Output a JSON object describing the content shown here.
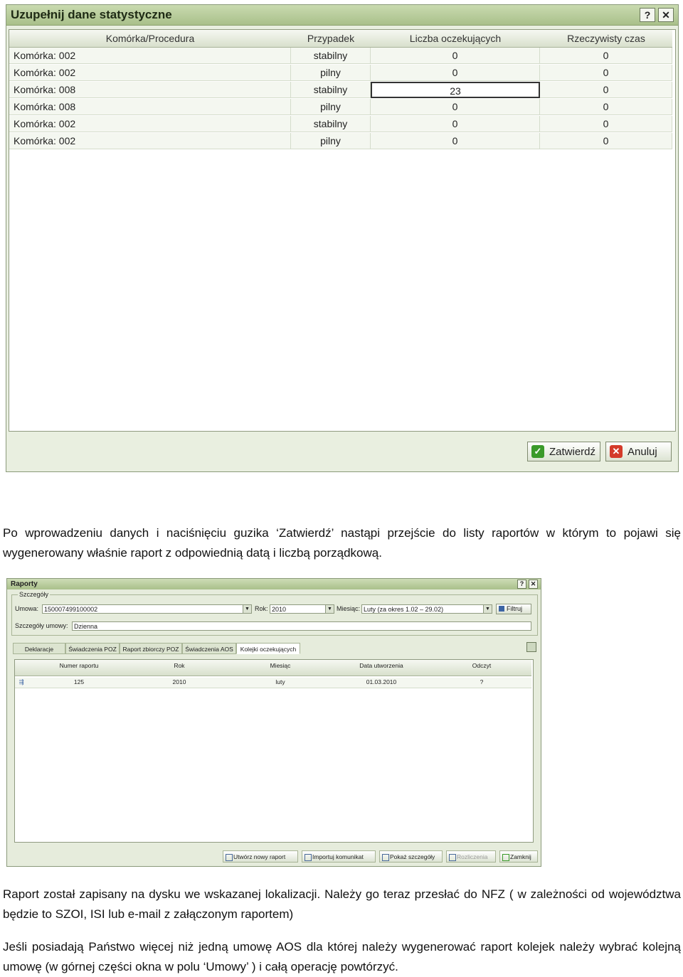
{
  "window1": {
    "title": "Uzupełnij dane statystyczne",
    "help": "?",
    "close": "✕",
    "columns": [
      "Komórka/Procedura",
      "Przypadek",
      "Liczba oczekujących",
      "Rzeczywisty czas"
    ],
    "rows": [
      {
        "cell": "Komórka:   002",
        "case": "stabilny",
        "waiting": "0",
        "time": "0"
      },
      {
        "cell": "Komórka:   002",
        "case": "pilny",
        "waiting": "0",
        "time": "0"
      },
      {
        "cell": "Komórka:   008",
        "case": "stabilny",
        "waiting": "23",
        "time": "0"
      },
      {
        "cell": "Komórka:   008",
        "case": "pilny",
        "waiting": "0",
        "time": "0"
      },
      {
        "cell": "Komórka:   002",
        "case": "stabilny",
        "waiting": "0",
        "time": "0"
      },
      {
        "cell": "Komórka:   002",
        "case": "pilny",
        "waiting": "0",
        "time": "0"
      }
    ],
    "confirm_label": "Zatwierdź",
    "cancel_label": "Anuluj"
  },
  "text": {
    "p1": "Po wprowadzeniu danych i naciśnięciu guzika ‘Zatwierdź’ nastąpi przejście do listy raportów w którym to pojawi się wygenerowany właśnie raport z odpowiednią datą i liczbą porządkową.",
    "p2": "Raport został zapisany na dysku we wskazanej lokalizacji. Należy go teraz przesłać do NFZ ( w zależności od województwa będzie to SZOI, ISI lub e-mail z załączonym raportem)",
    "p3": " Jeśli posiadają Państwo więcej niż jedną umowę AOS dla której należy wygenerować raport kolejek należy wybrać kolejną umowę (w górnej części okna w polu ‘Umowy’ ) i całą operację powtórzyć."
  },
  "window2": {
    "title": "Raporty",
    "help": "?",
    "close": "✕",
    "details_legend": "Szczegóły",
    "contract_label": "Umowa:",
    "contract_value": "150007499100002",
    "year_label": "Rok:",
    "year_value": "2010",
    "month_label": "Miesiąc:",
    "month_value": "Luty (za okres 1.02 – 29.02)",
    "filter_label": "Filtruj",
    "contract_details_label": "Szczegóły umowy:",
    "contract_details_value": "Dzienna",
    "tabs": [
      "Deklaracje",
      "Świadczenia POZ",
      "Raport zbiorczy POZ",
      "Świadczenia AOS",
      "Kolejki oczekujących"
    ],
    "columns": [
      "Numer raportu",
      "Rok",
      "Miesiąc",
      "Data utworzenia",
      "Odczyt"
    ],
    "row": {
      "number": "125",
      "year": "2010",
      "month": "luty",
      "date": "01.03.2010",
      "read": "?"
    },
    "buttons": {
      "new_report": "Utwórz nowy raport",
      "import": "Importuj komunikat",
      "show_details": "Pokaż szczegóły",
      "settlements": "Rozliczenia",
      "close": "Zamknij"
    }
  }
}
